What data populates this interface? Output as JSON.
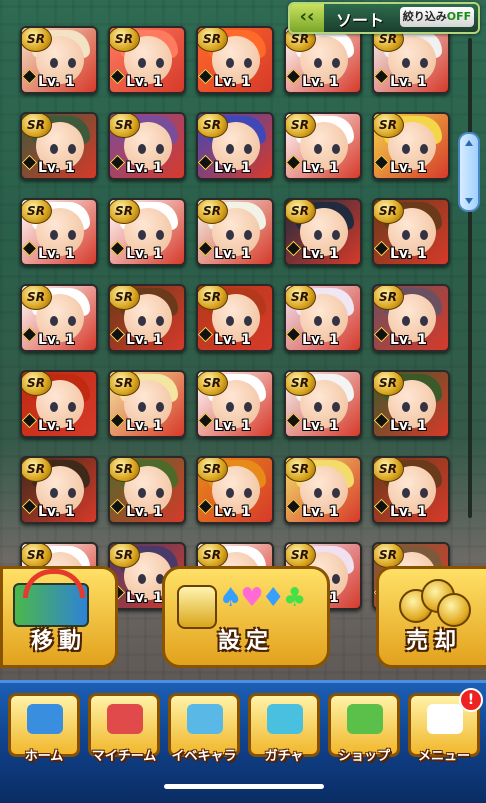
{
  "topbar": {
    "sort_label": "ソート",
    "filter_label": "絞り込み",
    "filter_state": "OFF",
    "collapse_arrow": "‹‹"
  },
  "cards": {
    "rarity": "SR",
    "level_label": "Lv. 1",
    "rows": [
      [
        "#f3e2c4",
        "#ff7b60",
        "#ff6a2a",
        "#ffffff",
        "#f1f1f1"
      ],
      [
        "#3e5a3a",
        "#7a4c9c",
        "#4048b8",
        "#ffffff",
        "#f4d64a"
      ],
      [
        "#ffffff",
        "#ffffff",
        "#f2f2e6",
        "#222b3e",
        "#6a3a1a"
      ],
      [
        "#ffffff",
        "#6b3a1a",
        "#b4391a",
        "#f0e6f4",
        "#6a5060"
      ],
      [
        "#c02a10",
        "#f4e6a0",
        "#ffffff",
        "#f4f4f4",
        "#3a5a2a"
      ],
      [
        "#3e2a1a",
        "#4e6a2a",
        "#e88a1a",
        "#f4dc6a",
        "#6a3a1a"
      ],
      [
        "#ffffff",
        "#4a3a6a",
        "#ffffff",
        "#f0e0f0",
        "#7a5a3a"
      ]
    ]
  },
  "actions": {
    "move_label": "移動",
    "set_label": "設定",
    "sell_label": "売却"
  },
  "nav": {
    "items": [
      {
        "label": "ホーム",
        "icon": "home-icon"
      },
      {
        "label": "マイチーム",
        "icon": "team-icon"
      },
      {
        "label": "イベキャラ",
        "icon": "event-character-icon"
      },
      {
        "label": "ガチャ",
        "icon": "gacha-icon"
      },
      {
        "label": "ショップ",
        "icon": "shop-icon"
      },
      {
        "label": "メニュー",
        "icon": "menu-icon"
      }
    ],
    "menu_badge": "!"
  },
  "colors": {
    "gold": "#e2a21d",
    "nav_blue": "#1b5fb4",
    "badge_red": "#e22222"
  }
}
